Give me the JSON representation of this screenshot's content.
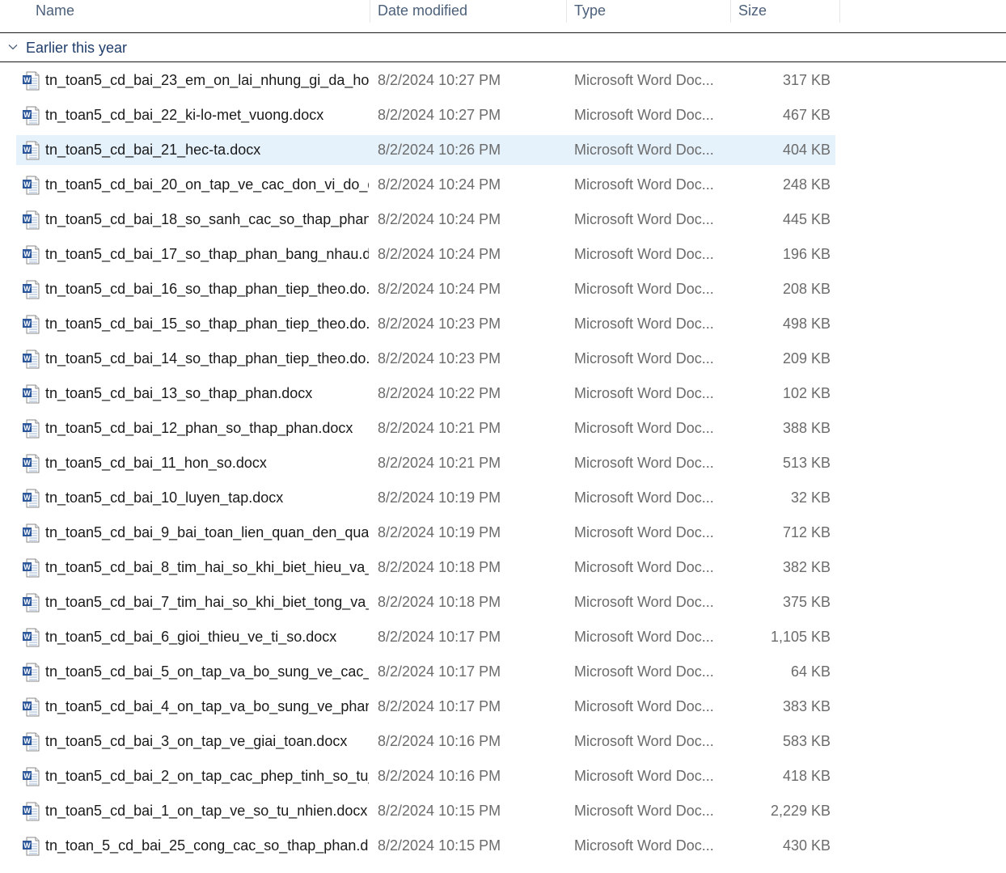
{
  "columns": {
    "name": "Name",
    "date_modified": "Date modified",
    "type": "Type",
    "size": "Size"
  },
  "group": {
    "label": "Earlier this year",
    "chevron_icon": "chevron-down-icon"
  },
  "files": [
    {
      "name": "tn_toan5_cd_bai_23_em_on_lai_nhung_gi_da_ho...",
      "date": "8/2/2024 10:27 PM",
      "type": "Microsoft Word Doc...",
      "size": "317 KB"
    },
    {
      "name": "tn_toan5_cd_bai_22_ki-lo-met_vuong.docx",
      "date": "8/2/2024 10:27 PM",
      "type": "Microsoft Word Doc...",
      "size": "467 KB"
    },
    {
      "name": "tn_toan5_cd_bai_21_hec-ta.docx",
      "date": "8/2/2024 10:26 PM",
      "type": "Microsoft Word Doc...",
      "size": "404 KB",
      "selected": true
    },
    {
      "name": "tn_toan5_cd_bai_20_on_tap_ve_cac_don_vi_do_d...",
      "date": "8/2/2024 10:24 PM",
      "type": "Microsoft Word Doc...",
      "size": "248 KB"
    },
    {
      "name": "tn_toan5_cd_bai_18_so_sanh_cac_so_thap_phan....",
      "date": "8/2/2024 10:24 PM",
      "type": "Microsoft Word Doc...",
      "size": "445 KB"
    },
    {
      "name": "tn_toan5_cd_bai_17_so_thap_phan_bang_nhau.d...",
      "date": "8/2/2024 10:24 PM",
      "type": "Microsoft Word Doc...",
      "size": "196 KB"
    },
    {
      "name": "tn_toan5_cd_bai_16_so_thap_phan_tiep_theo.do...",
      "date": "8/2/2024 10:24 PM",
      "type": "Microsoft Word Doc...",
      "size": "208 KB"
    },
    {
      "name": "tn_toan5_cd_bai_15_so_thap_phan_tiep_theo.do...",
      "date": "8/2/2024 10:23 PM",
      "type": "Microsoft Word Doc...",
      "size": "498 KB"
    },
    {
      "name": "tn_toan5_cd_bai_14_so_thap_phan_tiep_theo.do...",
      "date": "8/2/2024 10:23 PM",
      "type": "Microsoft Word Doc...",
      "size": "209 KB"
    },
    {
      "name": "tn_toan5_cd_bai_13_so_thap_phan.docx",
      "date": "8/2/2024 10:22 PM",
      "type": "Microsoft Word Doc...",
      "size": "102 KB"
    },
    {
      "name": "tn_toan5_cd_bai_12_phan_so_thap_phan.docx",
      "date": "8/2/2024 10:21 PM",
      "type": "Microsoft Word Doc...",
      "size": "388 KB"
    },
    {
      "name": "tn_toan5_cd_bai_11_hon_so.docx",
      "date": "8/2/2024 10:21 PM",
      "type": "Microsoft Word Doc...",
      "size": "513 KB"
    },
    {
      "name": "tn_toan5_cd_bai_10_luyen_tap.docx",
      "date": "8/2/2024 10:19 PM",
      "type": "Microsoft Word Doc...",
      "size": "32 KB"
    },
    {
      "name": "tn_toan5_cd_bai_9_bai_toan_lien_quan_den_qua...",
      "date": "8/2/2024 10:19 PM",
      "type": "Microsoft Word Doc...",
      "size": "712 KB"
    },
    {
      "name": "tn_toan5_cd_bai_8_tim_hai_so_khi_biet_hieu_va_t...",
      "date": "8/2/2024 10:18 PM",
      "type": "Microsoft Word Doc...",
      "size": "382 KB"
    },
    {
      "name": "tn_toan5_cd_bai_7_tim_hai_so_khi_biet_tong_va_...",
      "date": "8/2/2024 10:18 PM",
      "type": "Microsoft Word Doc...",
      "size": "375 KB"
    },
    {
      "name": "tn_toan5_cd_bai_6_gioi_thieu_ve_ti_so.docx",
      "date": "8/2/2024 10:17 PM",
      "type": "Microsoft Word Doc...",
      "size": "1,105 KB"
    },
    {
      "name": "tn_toan5_cd_bai_5_on_tap_va_bo_sung_ve_cac_...",
      "date": "8/2/2024 10:17 PM",
      "type": "Microsoft Word Doc...",
      "size": "64 KB"
    },
    {
      "name": "tn_toan5_cd_bai_4_on_tap_va_bo_sung_ve_phan...",
      "date": "8/2/2024 10:17 PM",
      "type": "Microsoft Word Doc...",
      "size": "383 KB"
    },
    {
      "name": "tn_toan5_cd_bai_3_on_tap_ve_giai_toan.docx",
      "date": "8/2/2024 10:16 PM",
      "type": "Microsoft Word Doc...",
      "size": "583 KB"
    },
    {
      "name": "tn_toan5_cd_bai_2_on_tap_cac_phep_tinh_so_tu_...",
      "date": "8/2/2024 10:16 PM",
      "type": "Microsoft Word Doc...",
      "size": "418 KB"
    },
    {
      "name": "tn_toan5_cd_bai_1_on_tap_ve_so_tu_nhien.docx",
      "date": "8/2/2024 10:15 PM",
      "type": "Microsoft Word Doc...",
      "size": "2,229 KB"
    },
    {
      "name": "tn_toan_5_cd_bai_25_cong_cac_so_thap_phan.d...",
      "date": "8/2/2024 10:15 PM",
      "type": "Microsoft Word Doc...",
      "size": "430 KB"
    }
  ],
  "file_icon": "word-document-icon",
  "colors": {
    "selected_row": "#e5f1fb",
    "header_text": "#4c607a",
    "group_text": "#1f3d6b",
    "word_blue": "#2b579a"
  }
}
